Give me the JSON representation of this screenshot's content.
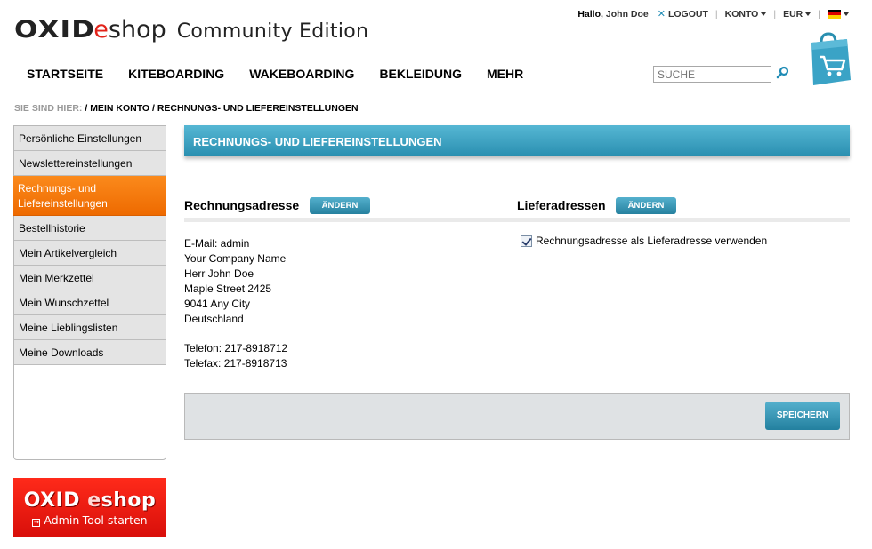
{
  "header": {
    "logo_oxid": "OXID",
    "logo_eshop_e": "e",
    "logo_eshop_rest": "shop",
    "logo_edition": "Community Edition",
    "greeting": "Hallo,",
    "user_name": "John Doe",
    "logout": "LOGOUT",
    "account": "KONTO",
    "currency": "EUR",
    "language_flag": "flag-de-icon"
  },
  "nav": {
    "items": [
      "STARTSEITE",
      "KITEBOARDING",
      "WAKEBOARDING",
      "BEKLEIDUNG",
      "MEHR"
    ]
  },
  "search": {
    "placeholder": "SUCHE"
  },
  "breadcrumb": {
    "label": "SIE SIND HIER:",
    "path": " / MEIN KONTO / RECHNUNGS- UND LIEFEREINSTELLUNGEN"
  },
  "sidebar": {
    "items": [
      {
        "label": "Persönliche Einstellungen",
        "active": false
      },
      {
        "label": "Newslettereinstellungen",
        "active": false
      },
      {
        "label": "Rechnungs- und Liefereinstellungen",
        "active": true
      },
      {
        "label": "Bestellhistorie",
        "active": false
      },
      {
        "label": "Mein Artikelvergleich",
        "active": false
      },
      {
        "label": "Mein Merkzettel",
        "active": false
      },
      {
        "label": "Mein Wunschzettel",
        "active": false
      },
      {
        "label": "Meine Lieblingslisten",
        "active": false
      },
      {
        "label": "Meine Downloads",
        "active": false
      }
    ]
  },
  "admin_banner": {
    "logo_oxid": "OXID",
    "logo_e": "e",
    "logo_rest": "shop",
    "link": "Admin-Tool starten"
  },
  "main": {
    "title": "RECHNUNGS- UND LIEFEREINSTELLUNGEN",
    "billing": {
      "title": "Rechnungsadresse",
      "change_button": "ÄNDERN",
      "email": "E-Mail: admin",
      "company": "Your Company Name",
      "name": "Herr John Doe",
      "street": "Maple Street 2425",
      "city": "9041 Any City",
      "country": "Deutschland",
      "phone": "Telefon: 217-8918712",
      "fax": "Telefax: 217-8918713"
    },
    "shipping": {
      "title": "Lieferadressen",
      "change_button": "ÄNDERN",
      "use_billing_label": "Rechnungsadresse als Lieferadresse verwenden",
      "use_billing_checked": true
    },
    "save_button": "SPEICHERN"
  },
  "colors": {
    "accent_blue": "#2a8fb0",
    "active_orange": "#f07300",
    "admin_red": "#e51a12"
  }
}
